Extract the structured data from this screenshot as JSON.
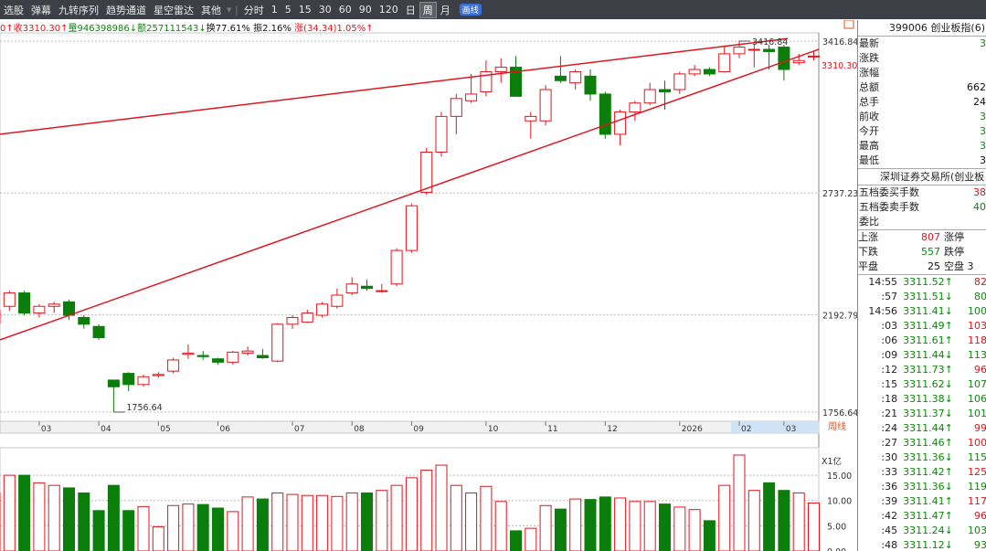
{
  "toolbar": {
    "items": [
      "选股",
      "弹幕",
      "九转序列",
      "趋势通道",
      "星空雷达",
      "其他",
      "分时",
      "1",
      "5",
      "15",
      "30",
      "60",
      "90",
      "120",
      "日",
      "周",
      "月"
    ],
    "active": "周",
    "badge": "画线"
  },
  "infoline": {
    "open": "0↑",
    "close": "收3310.30↑",
    "volume": "量946398986↓",
    "amount": "额257111543↓",
    "turnover": "换77.61%",
    "amplitude": "振2.16%",
    "change": "涨(34.34)1.05%↑"
  },
  "chart_data": {
    "type": "candlestick",
    "y_ticks": [
      "3416.84",
      "2737.23",
      "2192.79",
      "1756.64"
    ],
    "current_price_label": "3310.30",
    "high_annotation": "3416.84",
    "low_annotation": "1756.64",
    "x_labels": [
      "03",
      "04",
      "05",
      "06",
      "07",
      "08",
      "09",
      "10",
      "11",
      "12",
      "2026",
      "02",
      "03"
    ],
    "period_label": "周线",
    "volume_scale": "X1亿",
    "volume_ticks": [
      "15.00",
      "10.00",
      "5.00",
      "0.00"
    ],
    "candles": [
      {
        "o": 2155,
        "c": 2210,
        "h": 2230,
        "l": 2120,
        "v": 11.5
      },
      {
        "o": 2230,
        "c": 2290,
        "h": 2300,
        "l": 2210,
        "v": 15.0
      },
      {
        "o": 2290,
        "c": 2200,
        "h": 2300,
        "l": 2190,
        "v": 15.0
      },
      {
        "o": 2200,
        "c": 2230,
        "h": 2240,
        "l": 2180,
        "v": 13.5
      },
      {
        "o": 2230,
        "c": 2240,
        "h": 2250,
        "l": 2200,
        "v": 13.0
      },
      {
        "o": 2250,
        "c": 2190,
        "h": 2260,
        "l": 2170,
        "v": 12.5
      },
      {
        "o": 2180,
        "c": 2150,
        "h": 2190,
        "l": 2130,
        "v": 11.5
      },
      {
        "o": 2140,
        "c": 2090,
        "h": 2150,
        "l": 2080,
        "v": 8.0
      },
      {
        "o": 1900,
        "c": 1870,
        "h": 1900,
        "l": 1756.64,
        "v": 13.0
      },
      {
        "o": 1930,
        "c": 1880,
        "h": 1935,
        "l": 1850,
        "v": 8.0
      },
      {
        "o": 1880,
        "c": 1915,
        "h": 1925,
        "l": 1870,
        "v": 8.8
      },
      {
        "o": 1920,
        "c": 1925,
        "h": 1935,
        "l": 1910,
        "v": 4.8
      },
      {
        "o": 1940,
        "c": 1990,
        "h": 2000,
        "l": 1930,
        "v": 9.0
      },
      {
        "o": 2015,
        "c": 2020,
        "h": 2060,
        "l": 1995,
        "v": 9.3
      },
      {
        "o": 2010,
        "c": 2005,
        "h": 2030,
        "l": 1990,
        "v": 9.2
      },
      {
        "o": 1995,
        "c": 1980,
        "h": 2000,
        "l": 1970,
        "v": 8.5
      },
      {
        "o": 1980,
        "c": 2025,
        "h": 2030,
        "l": 1970,
        "v": 7.8
      },
      {
        "o": 2020,
        "c": 2030,
        "h": 2050,
        "l": 2010,
        "v": 10.7
      },
      {
        "o": 2010,
        "c": 2000,
        "h": 2040,
        "l": 1995,
        "v": 10.3
      },
      {
        "o": 1985,
        "c": 2150,
        "h": 2155,
        "l": 1980,
        "v": 11.5
      },
      {
        "o": 2150,
        "c": 2180,
        "h": 2190,
        "l": 2130,
        "v": 11.2
      },
      {
        "o": 2160,
        "c": 2200,
        "h": 2215,
        "l": 2155,
        "v": 11.0
      },
      {
        "o": 2190,
        "c": 2240,
        "h": 2250,
        "l": 2180,
        "v": 11.0
      },
      {
        "o": 2230,
        "c": 2280,
        "h": 2310,
        "l": 2220,
        "v": 10.8
      },
      {
        "o": 2290,
        "c": 2330,
        "h": 2360,
        "l": 2280,
        "v": 11.5
      },
      {
        "o": 2320,
        "c": 2310,
        "h": 2350,
        "l": 2300,
        "v": 11.5
      },
      {
        "o": 2300,
        "c": 2300,
        "h": 2330,
        "l": 2290,
        "v": 12.0
      },
      {
        "o": 2330,
        "c": 2480,
        "h": 2490,
        "l": 2320,
        "v": 13.0
      },
      {
        "o": 2480,
        "c": 2680,
        "h": 2690,
        "l": 2470,
        "v": 14.5
      },
      {
        "o": 2740,
        "c": 2920,
        "h": 2940,
        "l": 2730,
        "v": 16.0
      },
      {
        "o": 2920,
        "c": 3080,
        "h": 3100,
        "l": 2900,
        "v": 17.0
      },
      {
        "o": 3080,
        "c": 3160,
        "h": 3180,
        "l": 3000,
        "v": 13.0
      },
      {
        "o": 3150,
        "c": 3180,
        "h": 3270,
        "l": 3140,
        "v": 11.5
      },
      {
        "o": 3190,
        "c": 3280,
        "h": 3330,
        "l": 3170,
        "v": 12.8
      },
      {
        "o": 3280,
        "c": 3300,
        "h": 3340,
        "l": 3230,
        "v": 9.8
      },
      {
        "o": 3300,
        "c": 3170,
        "h": 3350,
        "l": 3170,
        "v": 4.0
      },
      {
        "o": 3060,
        "c": 3080,
        "h": 3100,
        "l": 2980,
        "v": 4.5
      },
      {
        "o": 3060,
        "c": 3200,
        "h": 3220,
        "l": 3040,
        "v": 9.0
      },
      {
        "o": 3260,
        "c": 3240,
        "h": 3350,
        "l": 3230,
        "v": 8.3
      },
      {
        "o": 3230,
        "c": 3280,
        "h": 3290,
        "l": 3200,
        "v": 10.3
      },
      {
        "o": 3260,
        "c": 3180,
        "h": 3290,
        "l": 3150,
        "v": 10.2
      },
      {
        "o": 3180,
        "c": 3000,
        "h": 3190,
        "l": 2980,
        "v": 10.7
      },
      {
        "o": 3000,
        "c": 3100,
        "h": 3110,
        "l": 2950,
        "v": 10.5
      },
      {
        "o": 3100,
        "c": 3140,
        "h": 3150,
        "l": 3060,
        "v": 9.8
      },
      {
        "o": 3140,
        "c": 3200,
        "h": 3230,
        "l": 3130,
        "v": 9.8
      },
      {
        "o": 3200,
        "c": 3190,
        "h": 3240,
        "l": 3110,
        "v": 9.3
      },
      {
        "o": 3200,
        "c": 3270,
        "h": 3280,
        "l": 3180,
        "v": 8.7
      },
      {
        "o": 3270,
        "c": 3290,
        "h": 3310,
        "l": 3260,
        "v": 8.2
      },
      {
        "o": 3290,
        "c": 3270,
        "h": 3300,
        "l": 3260,
        "v": 6.0
      },
      {
        "o": 3280,
        "c": 3360,
        "h": 3390,
        "l": 3280,
        "v": 13.0
      },
      {
        "o": 3360,
        "c": 3390,
        "h": 3416.84,
        "l": 3340,
        "v": 19.0
      },
      {
        "o": 3380,
        "c": 3380,
        "h": 3400,
        "l": 3300,
        "v": 12.0
      },
      {
        "o": 3380,
        "c": 3370,
        "h": 3400,
        "l": 3290,
        "v": 13.5
      },
      {
        "o": 3390,
        "c": 3290,
        "h": 3400,
        "l": 3240,
        "v": 12.0
      },
      {
        "o": 3320,
        "c": 3330,
        "h": 3360,
        "l": 3310,
        "v": 11.5
      },
      {
        "o": 3350,
        "c": 3350,
        "h": 3370,
        "l": 3330,
        "v": 9.5
      }
    ]
  },
  "side": {
    "title": "399006 创业板指(6)",
    "stats": [
      {
        "label": "最新",
        "value": "3"
      },
      {
        "label": "涨跌",
        "value": ""
      },
      {
        "label": "涨幅",
        "value": ""
      },
      {
        "label": "总额",
        "value": "662"
      },
      {
        "label": "总手",
        "value": "24"
      },
      {
        "label": "前收",
        "value": "3"
      },
      {
        "label": "今开",
        "value": "3"
      },
      {
        "label": "最高",
        "value": "3"
      },
      {
        "label": "最低",
        "value": "3"
      }
    ],
    "exchange": "深圳证券交易所(创业板",
    "bids": [
      {
        "label": "五档委买手数",
        "value": "38"
      },
      {
        "label": "五档委卖手数",
        "value": "40"
      },
      {
        "label": "委比",
        "value": ""
      }
    ],
    "breadth": [
      {
        "a": "上涨",
        "b": "807",
        "c": "涨停"
      },
      {
        "a": "下跌",
        "b": "557",
        "c": "跌停"
      },
      {
        "a": "平盘",
        "b": "25",
        "c": "空盘 3"
      }
    ],
    "ticks": [
      {
        "t": "14:55",
        "p": "3311.52↑",
        "q": "82"
      },
      {
        "t": ":57",
        "p": "3311.51↓",
        "q": "80"
      },
      {
        "t": "14:56",
        "p": "3311.41↓",
        "q": "100"
      },
      {
        "t": ":03",
        "p": "3311.49↑",
        "q": "103"
      },
      {
        "t": ":06",
        "p": "3311.61↑",
        "q": "118"
      },
      {
        "t": ":09",
        "p": "3311.44↓",
        "q": "113"
      },
      {
        "t": ":12",
        "p": "3311.73↑",
        "q": "96"
      },
      {
        "t": ":15",
        "p": "3311.62↓",
        "q": "107"
      },
      {
        "t": ":18",
        "p": "3311.38↓",
        "q": "106"
      },
      {
        "t": ":21",
        "p": "3311.37↓",
        "q": "101"
      },
      {
        "t": ":24",
        "p": "3311.44↑",
        "q": "99"
      },
      {
        "t": ":27",
        "p": "3311.46↑",
        "q": "100"
      },
      {
        "t": ":30",
        "p": "3311.36↓",
        "q": "115"
      },
      {
        "t": ":33",
        "p": "3311.42↑",
        "q": "125"
      },
      {
        "t": ":36",
        "p": "3311.36↓",
        "q": "119"
      },
      {
        "t": ":39",
        "p": "3311.41↑",
        "q": "117"
      },
      {
        "t": ":42",
        "p": "3311.47↑",
        "q": "96"
      },
      {
        "t": ":45",
        "p": "3311.24↓",
        "q": "103"
      },
      {
        "t": ":48",
        "p": "3311.12↓",
        "q": "93"
      }
    ]
  }
}
